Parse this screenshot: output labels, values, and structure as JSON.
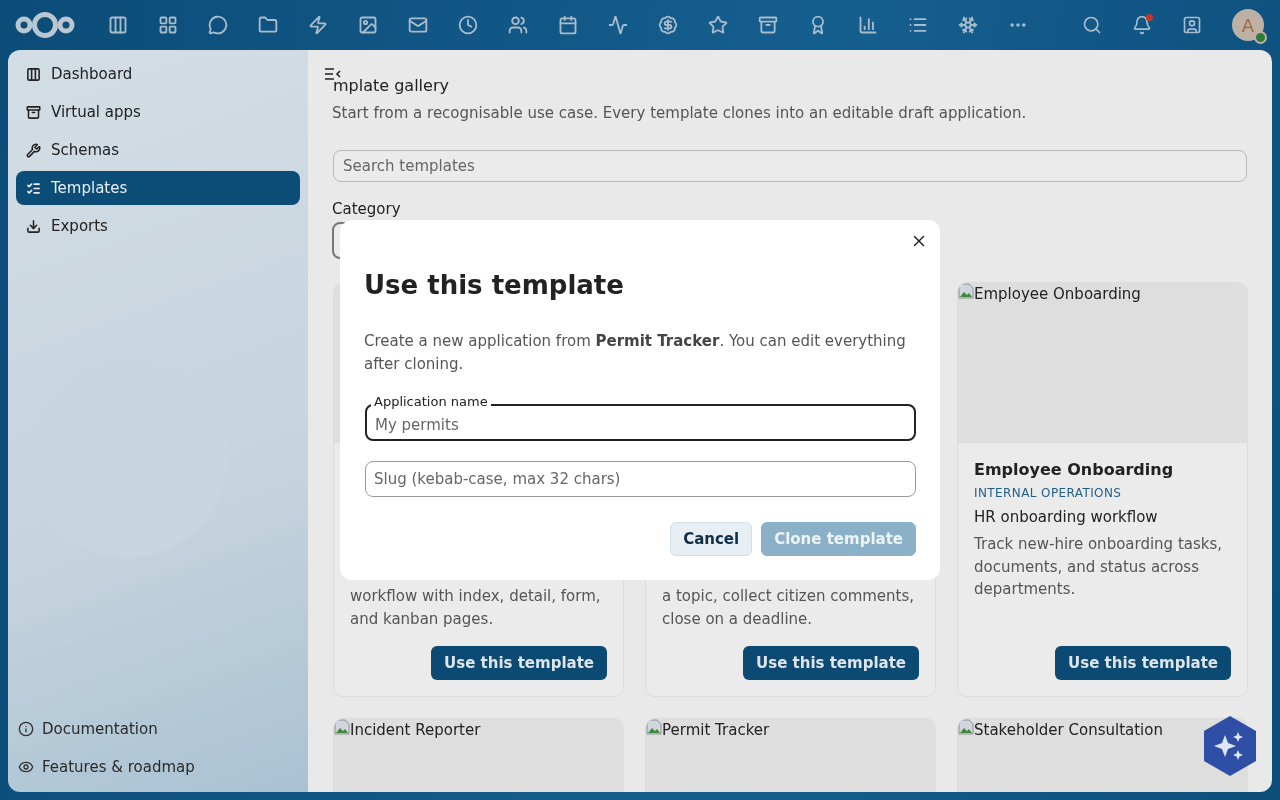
{
  "header": {
    "notifications": {
      "unread": true
    },
    "avatar": {
      "initial": "A",
      "online": true
    }
  },
  "sidebar": {
    "items": [
      {
        "label": "Dashboard",
        "selected": false
      },
      {
        "label": "Virtual apps",
        "selected": false
      },
      {
        "label": "Schemas",
        "selected": false
      },
      {
        "label": "Templates",
        "selected": true
      },
      {
        "label": "Exports",
        "selected": false
      }
    ],
    "footer": [
      {
        "label": "Documentation"
      },
      {
        "label": "Features & roadmap"
      }
    ]
  },
  "page": {
    "title": "mplate gallery",
    "subtitle": "Start from a recognisable use case. Every template clones into an editable draft application.",
    "search": {
      "placeholder": "Search templates"
    },
    "category": {
      "label": "Category"
    }
  },
  "templates": [
    {
      "description": "workflow with index, detail, form, and kanban pages.",
      "button": "Use this template"
    },
    {
      "description": "a topic, collect citizen comments, close on a deadline.",
      "button": "Use this template"
    },
    {
      "image_alt": "Employee Onboarding",
      "title": "Employee Onboarding",
      "category": "INTERNAL OPERATIONS",
      "subtitle": "HR onboarding workflow",
      "description": "Track new-hire onboarding tasks, documents, and status across departments.",
      "button": "Use this template"
    },
    {
      "image_alt": "Incident Reporter"
    },
    {
      "image_alt": "Permit Tracker"
    },
    {
      "image_alt": "Stakeholder Consultation"
    }
  ],
  "dialog": {
    "title": "Use this template",
    "description": "Create a new application from **Permit Tracker**. You can edit everything after cloning.",
    "fields": [
      {
        "label": "Application name",
        "placeholder": "My permits",
        "focused": true
      },
      {
        "placeholder": "Slug (kebab-case, max 32 chars)",
        "focused": false
      }
    ],
    "buttons": [
      {
        "label": "Cancel",
        "kind": "secondary",
        "disabled": false
      },
      {
        "label": "Clone template",
        "kind": "primary",
        "disabled": true
      }
    ]
  }
}
